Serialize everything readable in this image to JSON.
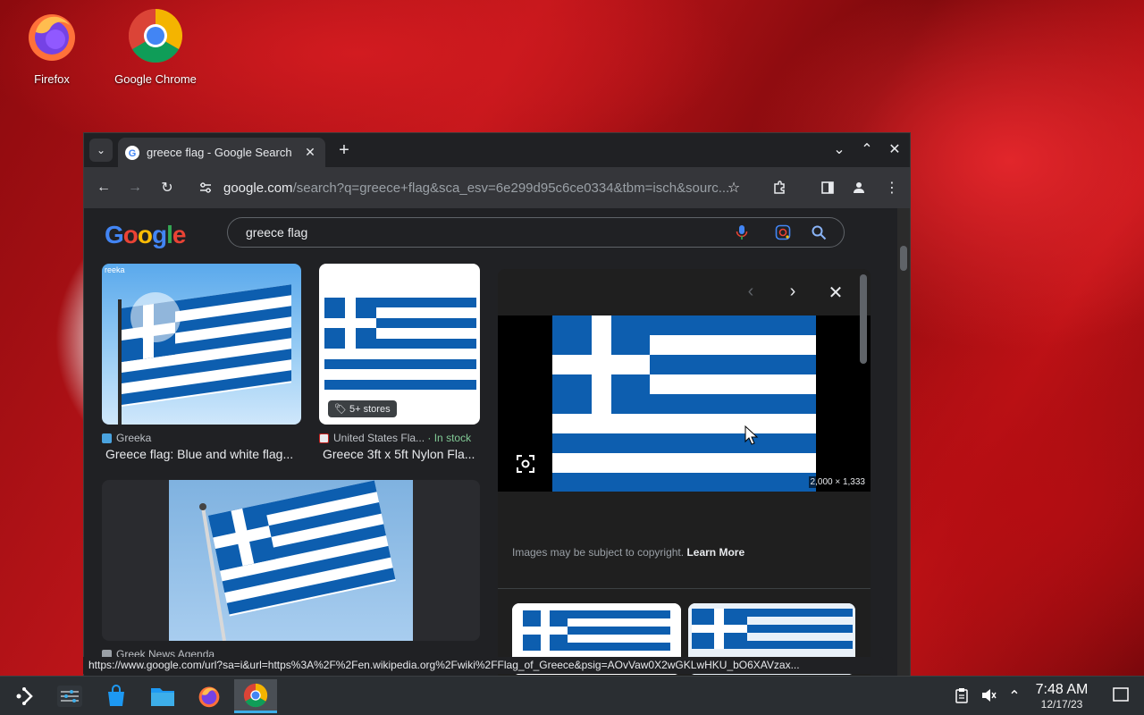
{
  "desktop": {
    "icons": [
      {
        "label": "Firefox"
      },
      {
        "label": "Google Chrome"
      }
    ]
  },
  "browser": {
    "tab": {
      "title": "greece flag - Google Search",
      "close": "✕"
    },
    "new_tab": "+",
    "window_controls": {
      "minimize": "⌄",
      "maximize": "⌃",
      "close": "✕"
    },
    "nav": {
      "back": "←",
      "forward": "→",
      "reload": "↻"
    },
    "url_host": "google.com",
    "url_path": "/search?q=greece+flag&sca_esv=6e299d95c6ce0334&tbm=isch&sourc..."
  },
  "search": {
    "query": "greece flag"
  },
  "results": [
    {
      "source": "Greeka",
      "title": "Greece flag: Blue and white flag...",
      "mark": "reeka"
    },
    {
      "source": "United States Fla...",
      "stock": "· In stock",
      "title": "Greece 3ft x 5ft Nylon Fla...",
      "badge": "5+ stores"
    },
    {
      "source": "Greek News Agenda",
      "title": ""
    }
  ],
  "preview": {
    "dimensions": "2,000 × 1,333",
    "copyright_text": "Images may be subject to copyright.",
    "learn_more": "Learn More"
  },
  "status_url": "https://www.google.com/url?sa=i&url=https%3A%2F%2Fen.wikipedia.org%2Fwiki%2FFlag_of_Greece&psig=AOvVaw0X2wGKLwHKU_bO6XAVzax...",
  "taskbar": {
    "time": "7:48 AM",
    "date": "12/17/23"
  },
  "colors": {
    "flag_blue": "#0d5eaf",
    "accent": "#3daee9",
    "bg_dark": "#202124"
  }
}
